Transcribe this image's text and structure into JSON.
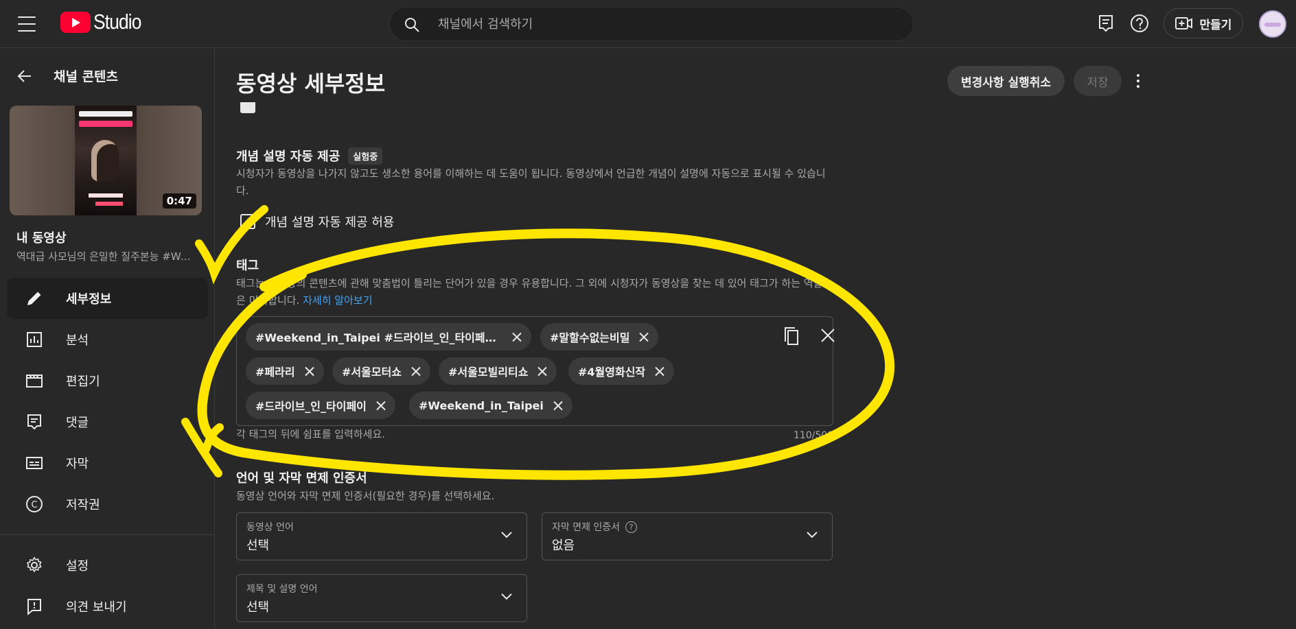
{
  "topbar": {
    "logo_text": "Studio",
    "search_placeholder": "채널에서 검색하기",
    "create_label": "만들기"
  },
  "sidebar": {
    "back_label": "채널 콘텐츠",
    "thumbnail_duration": "0:47",
    "my_video_label": "내 동영상",
    "video_title": "역대급 사모님의 은밀한 질주본능 #We...",
    "items": [
      {
        "label": "세부정보",
        "icon": "pencil-icon",
        "active": true
      },
      {
        "label": "분석",
        "icon": "analytics-icon",
        "active": false
      },
      {
        "label": "편집기",
        "icon": "editor-icon",
        "active": false
      },
      {
        "label": "댓글",
        "icon": "comments-icon",
        "active": false
      },
      {
        "label": "자막",
        "icon": "subtitles-icon",
        "active": false
      },
      {
        "label": "저작권",
        "icon": "copyright-icon",
        "active": false
      }
    ],
    "bottom_items": [
      {
        "label": "설정",
        "icon": "gear-icon"
      },
      {
        "label": "의견 보내기",
        "icon": "feedback-icon"
      }
    ]
  },
  "main": {
    "page_title": "동영상 세부정보",
    "undo_label": "변경사항 실행취소",
    "save_label": "저장",
    "concepts": {
      "title": "개념 설명 자동 제공",
      "badge": "실험중",
      "description": "시청자가 동영상을 나가지 않고도 생소한 용어를 이해하는 데 도움이 됩니다. 동영상에서 언급한 개념이 설명에 자동으로 표시될 수 있습니다.",
      "checkbox_label": "개념 설명 자동 제공 허용"
    },
    "tags": {
      "title": "태그",
      "description": "태그는 동영상의 콘텐츠에 관해 맞춤법이 틀리는 단어가 있을 경우 유용합니다. 그 외에 시청자가 동영상을 찾는 데 있어 태그가 하는 역할은 미미합니다.",
      "learn_more": "자세히 알아보기",
      "chips": [
        "#Weekend_in_Taipei #드라이브_인_타이페이 ...",
        "#말할수없는비밀",
        "#페라리",
        "#서울모터쇼",
        "#서울모빌리티쇼",
        "#4월영화신작",
        "#드라이브_인_타이페이",
        "#Weekend_in_Taipei"
      ],
      "hint": "각 태그의 뒤에 쉼표를 입력하세요.",
      "count": "110/500"
    },
    "language": {
      "title": "언어 및 자막 면제 인증서",
      "description": "동영상 언어와 자막 면제 인증서(필요한 경우)를 선택하세요.",
      "video_language_label": "동영상 언어",
      "video_language_value": "선택",
      "caption_cert_label": "자막 면제 인증서",
      "caption_cert_value": "없음",
      "title_desc_language_label": "제목 및 설명 언어",
      "title_desc_language_value": "선택"
    }
  },
  "colors": {
    "background": "#282828",
    "accent_link": "#3ea6ff",
    "logo_red": "#ff0033",
    "annotation_yellow": "#ffe600"
  }
}
